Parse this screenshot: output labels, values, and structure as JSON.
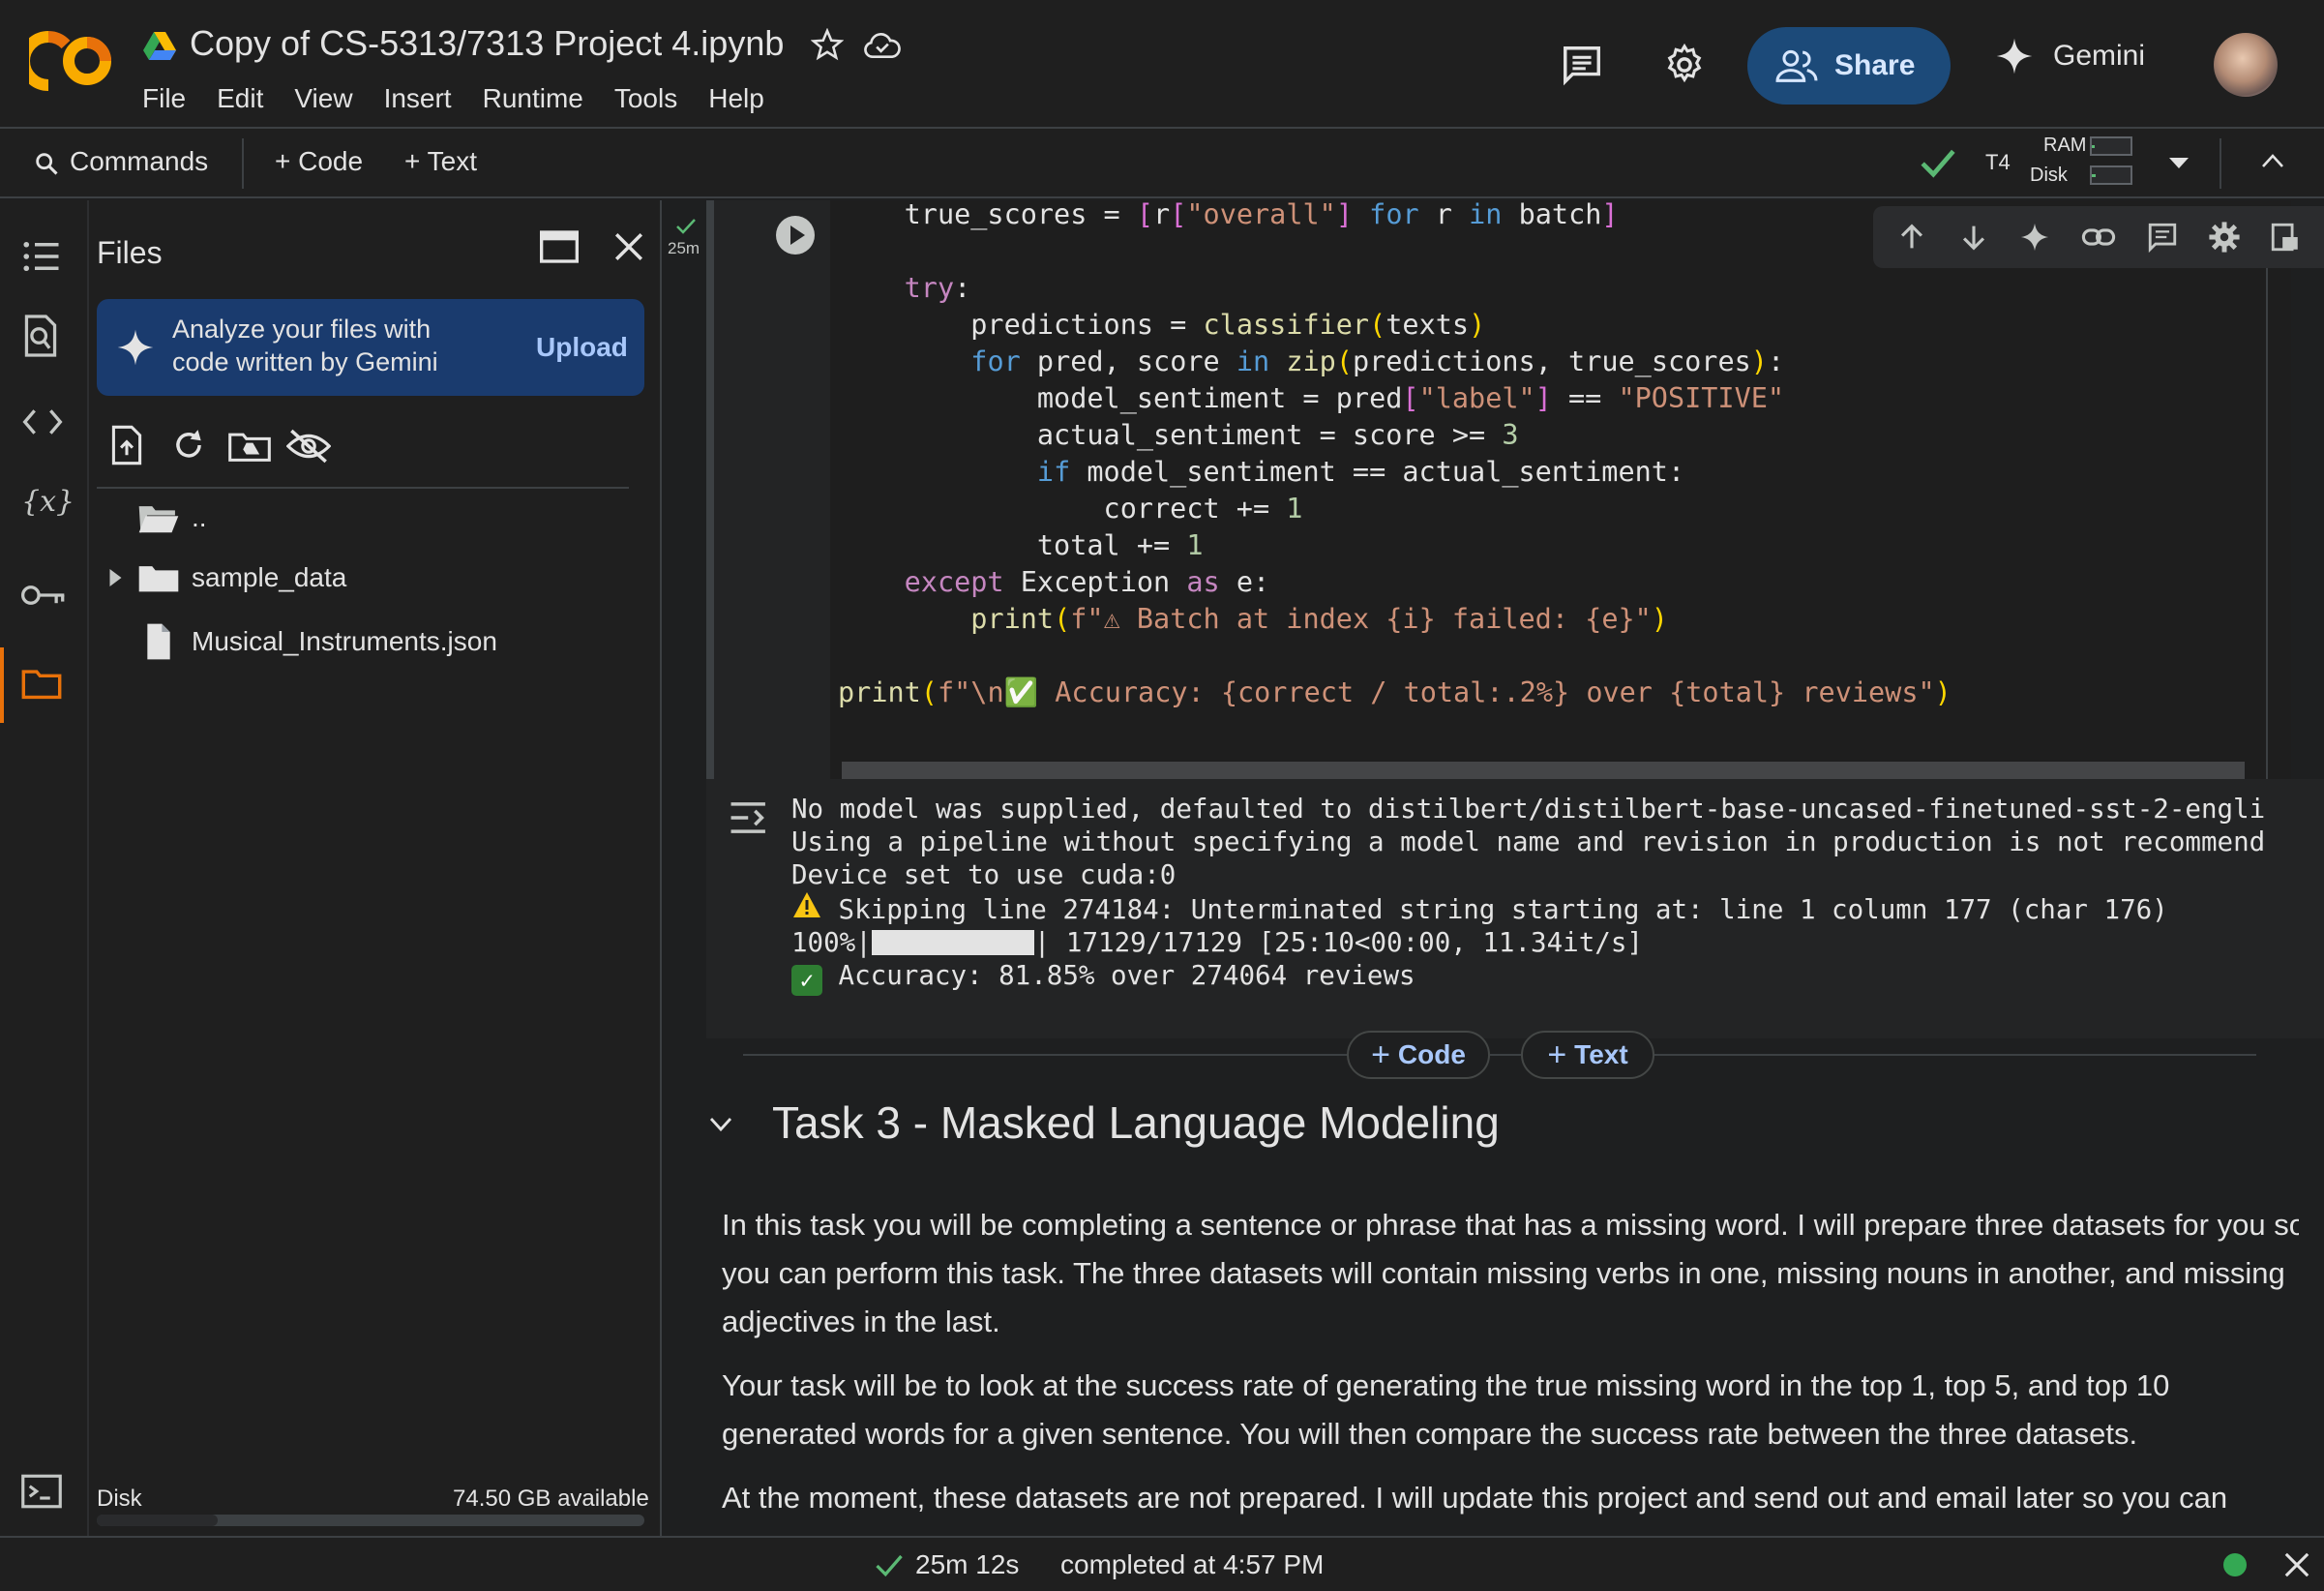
{
  "header": {
    "title": "Copy of CS-5313/7313 Project 4.ipynb",
    "menu": [
      "File",
      "Edit",
      "View",
      "Insert",
      "Runtime",
      "Tools",
      "Help"
    ],
    "share_label": "Share",
    "gemini_label": "Gemini"
  },
  "toolbar": {
    "commands_label": "Commands",
    "code_label": "+ Code",
    "text_label": "+ Text",
    "runtime_type": "T4",
    "ram_label": "RAM",
    "disk_label": "Disk",
    "ram_usage_fraction": 0.08,
    "disk_usage_fraction": 0.1
  },
  "files_panel": {
    "title": "Files",
    "banner_text": "Analyze your files with code written by Gemini",
    "upload_label": "Upload",
    "tree": [
      {
        "name": "..",
        "type": "parent-folder"
      },
      {
        "name": "sample_data",
        "type": "folder"
      },
      {
        "name": "Musical_Instruments.json",
        "type": "file"
      }
    ],
    "disk_label": "Disk",
    "disk_available": "74.50 GB available",
    "disk_usage_fraction": 0.22
  },
  "cell": {
    "exec_time": "25m",
    "code_lines": [
      "    true_scores = [r[\"overall\"] for r in batch]",
      "",
      "    try:",
      "        predictions = classifier(texts)",
      "        for pred, score in zip(predictions, true_scores):",
      "            model_sentiment = pred[\"label\"] == \"POSITIVE\"",
      "            actual_sentiment = score >= 3",
      "            if model_sentiment == actual_sentiment:",
      "                correct += 1",
      "            total += 1",
      "    except Exception as e:",
      "        print(f\"⚠ Batch at index {i} failed: {e}\")",
      "",
      "print(f\"\\n✅ Accuracy: {correct / total:.2%} over {total} reviews\")"
    ],
    "output": {
      "line1": "No model was supplied, defaulted to distilbert/distilbert-base-uncased-finetuned-sst-2-engli",
      "line2": "Using a pipeline without specifying a model name and revision in production is not recommend",
      "line3": "Device set to use cuda:0",
      "line4": " Skipping line 274184: Unterminated string starting at: line 1 column 177 (char 176)",
      "line5_prefix": "100%|",
      "line5_suffix": "| 17129/17129 [25:10<00:00, 11.34it/s]",
      "line5_progress": 1.0,
      "line6": " Accuracy: 81.85% over 274064 reviews"
    }
  },
  "add_cell": {
    "code_label": "Code",
    "text_label": "Text"
  },
  "section": {
    "title": "Task 3 - Masked Language Modeling",
    "paragraphs": [
      "In this task you will be completing a sentence or phrase that has a missing word. I will prepare three datasets for you so you can perform this task. The three datasets will contain missing verbs in one, missing nouns in another, and missing adjectives in the last.",
      "Your task will be to look at the success rate of generating the true missing word in the top 1, top 5, and top 10 generated words for a given sentence. You will then compare the success rate between the three datasets.",
      "At the moment, these datasets are not prepared. I will update this project and send out and email later so you can"
    ]
  },
  "status": {
    "duration": "25m 12s",
    "completed": "completed at 4:57 PM"
  },
  "colors": {
    "share_bg": "#1c4a79",
    "banner_bg": "#1a3b6e",
    "status_ok": "#34a853",
    "check_green": "#5bb974"
  }
}
